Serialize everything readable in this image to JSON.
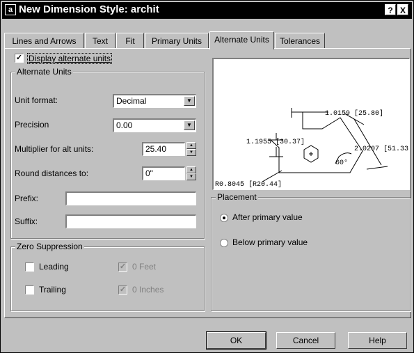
{
  "window": {
    "title": "New Dimension Style: archit",
    "help_glyph": "?",
    "close_glyph": "X"
  },
  "tabs": [
    {
      "label": "Lines and Arrows"
    },
    {
      "label": "Text"
    },
    {
      "label": "Fit"
    },
    {
      "label": "Primary Units"
    },
    {
      "label": "Alternate Units",
      "active": true
    },
    {
      "label": "Tolerances"
    }
  ],
  "display_alt_units": {
    "label": "Display alternate units",
    "checked": true
  },
  "alternate_units": {
    "title": "Alternate Units",
    "unit_format": {
      "label": "Unit format:",
      "value": "Decimal"
    },
    "precision": {
      "label": "Precision",
      "value": "0.00"
    },
    "multiplier": {
      "label": "Multiplier for alt units:",
      "value": "25.40"
    },
    "round": {
      "label": "Round distances  to:",
      "value": "0\""
    },
    "prefix": {
      "label": "Prefix:",
      "value": ""
    },
    "suffix": {
      "label": "Suffix:",
      "value": ""
    }
  },
  "zero_suppression": {
    "title": "Zero Suppression",
    "leading": {
      "label": "Leading",
      "checked": false
    },
    "trailing": {
      "label": "Trailing",
      "checked": false
    },
    "feet": {
      "label": "0 Feet",
      "checked": true,
      "enabled": false
    },
    "inches": {
      "label": "0 Inches",
      "checked": true,
      "enabled": false
    }
  },
  "preview": {
    "dim_top": "1.0159 [25.80]",
    "dim_left": "1.1955 [30.37]",
    "dim_right": "2.0207 [51.33]",
    "angle": "60°",
    "radius": "R0.8045 [R20.44]"
  },
  "placement": {
    "title": "Placement",
    "options": [
      {
        "label": "After primary value",
        "selected": true
      },
      {
        "label": "Below primary value",
        "selected": false
      }
    ]
  },
  "buttons": {
    "ok": "OK",
    "cancel": "Cancel",
    "help": "Help"
  }
}
